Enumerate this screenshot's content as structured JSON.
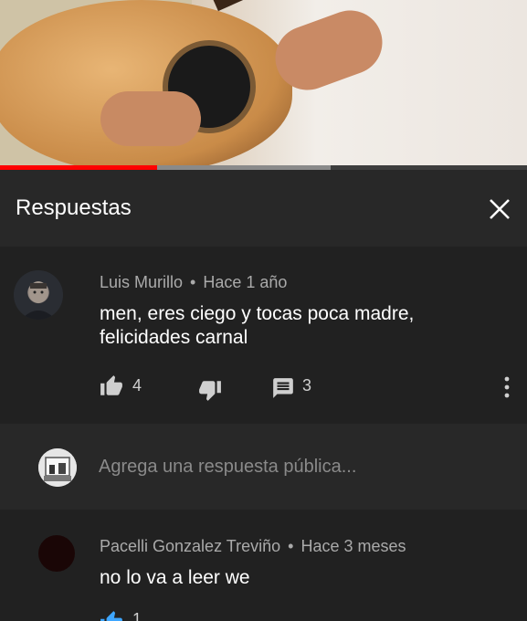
{
  "panel": {
    "title": "Respuestas"
  },
  "comment": {
    "author": "Luis Murillo",
    "time": "Hace 1 año",
    "line1": "men, eres ciego y tocas poca madre,",
    "line2": "felicidades carnal",
    "likes": "4",
    "replies": "3"
  },
  "reply_box": {
    "placeholder": "Agrega una respuesta pública..."
  },
  "reply": {
    "author": "Pacelli Gonzalez Treviño",
    "time": "Hace 3 meses",
    "text": "no lo va a leer we",
    "likes": "1"
  },
  "separator": "•",
  "colors": {
    "panel_bg": "#212121",
    "header_bg": "#282828",
    "progress_played": "#ff0000",
    "like_accent": "#3ea6ff"
  },
  "icons": [
    "close-icon",
    "like-icon",
    "dislike-icon",
    "reply-icon",
    "more-vert-icon"
  ]
}
